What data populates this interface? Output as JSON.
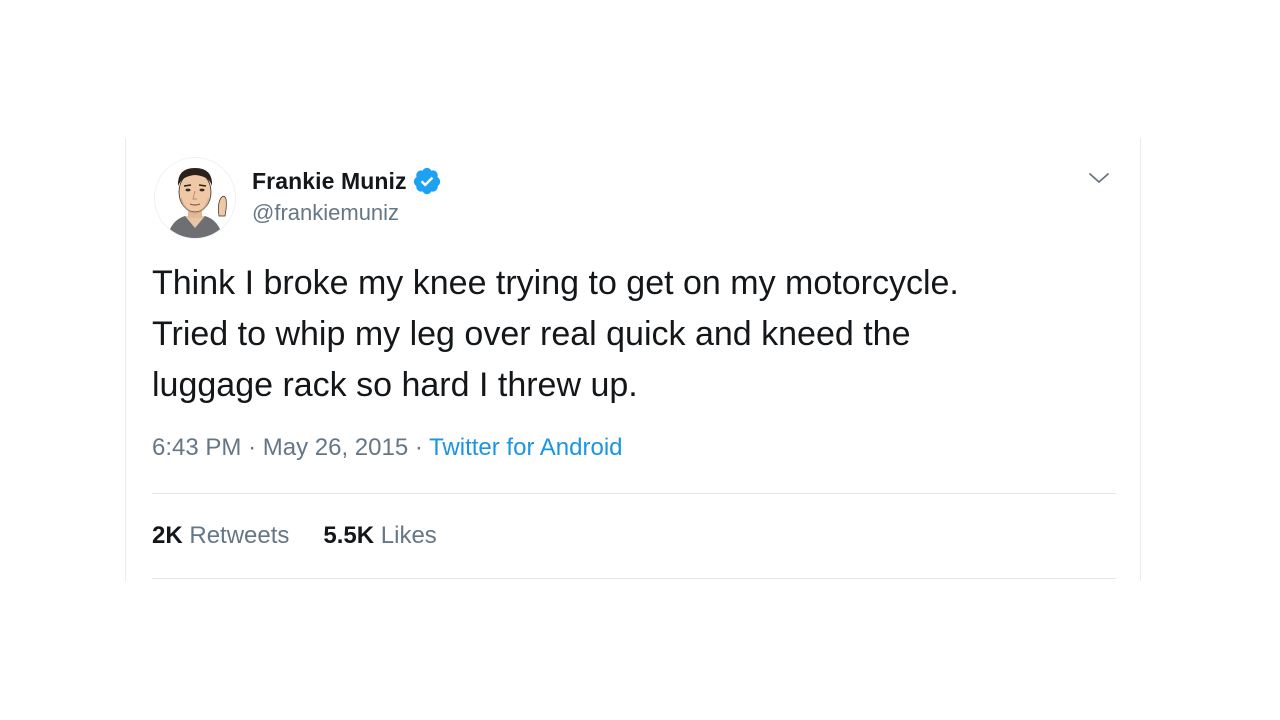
{
  "tweet": {
    "author": {
      "display_name": "Frankie Muniz",
      "handle": "@frankiemuniz",
      "verified": true
    },
    "text_lines": [
      "Think I broke my knee trying to get on my motorcycle.",
      "Tried to whip my leg over real quick and kneed the",
      "luggage rack so hard I threw up."
    ],
    "time": "6:43 PM",
    "separator": "·",
    "date": "May 26, 2015",
    "source": "Twitter for Android",
    "stats": {
      "retweets_count": "2K",
      "retweets_label": "Retweets",
      "likes_count": "5.5K",
      "likes_label": "Likes"
    }
  },
  "icons": {
    "verified": "verified-badge-icon",
    "menu": "chevron-down-icon"
  },
  "colors": {
    "text_primary": "#14171a",
    "text_secondary": "#657786",
    "link": "#1b95e0",
    "verified": "#1da1f2",
    "divider": "#e1e8ed"
  }
}
